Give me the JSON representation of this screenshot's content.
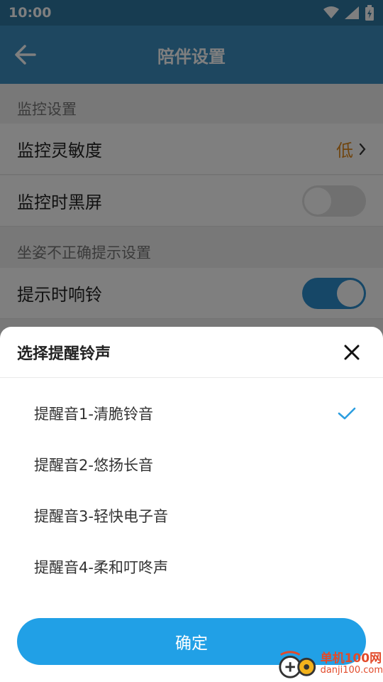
{
  "status_bar": {
    "time": "10:00"
  },
  "app_bar": {
    "title": "陪伴设置"
  },
  "settings": {
    "section1": "监控设置",
    "sensitivity": {
      "label": "监控灵敏度",
      "value": "低"
    },
    "black_screen": {
      "label": "监控时黑屏",
      "on": false
    },
    "section2": "坐姿不正确提示设置",
    "ring": {
      "label": "提示时响铃",
      "on": true
    }
  },
  "sheet": {
    "title": "选择提醒铃声",
    "options": [
      {
        "label": "提醒音1-清脆铃音",
        "selected": true
      },
      {
        "label": "提醒音2-悠扬长音",
        "selected": false
      },
      {
        "label": "提醒音3-轻快电子音",
        "selected": false
      },
      {
        "label": "提醒音4-柔和叮咚声",
        "selected": false
      }
    ],
    "confirm_label": "确定"
  },
  "watermark": {
    "cn": "单机100网",
    "en": "danji100.com"
  },
  "colors": {
    "app_bar": "#3c8ec0",
    "accent": "#2c8fcf",
    "confirm": "#21a0e6",
    "value": "#e08a1e"
  }
}
